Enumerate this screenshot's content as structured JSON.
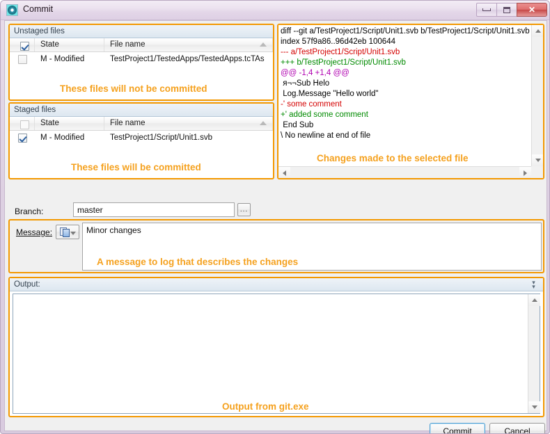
{
  "window": {
    "title": "Commit",
    "icon": "gear-icon",
    "controls": {
      "minimize": "minimize",
      "maximize": "maximize",
      "close": "✕"
    }
  },
  "unstaged": {
    "caption": "Unstaged files",
    "columns": {
      "check": "",
      "state": "State",
      "file": "File name"
    },
    "header_checkbox_checked": true,
    "rows": [
      {
        "checked": false,
        "state": "M - Modified",
        "file": "TestProject1/TestedApps/TestedApps.tcTAs"
      }
    ],
    "annotation": "These files will not be committed"
  },
  "staged": {
    "caption": "Staged files",
    "columns": {
      "check": "",
      "state": "State",
      "file": "File name"
    },
    "header_checkbox_checked": false,
    "rows": [
      {
        "checked": true,
        "state": "M - Modified",
        "file": "TestProject1/Script/Unit1.svb"
      }
    ],
    "annotation": "These files will be committed"
  },
  "diff": {
    "lines": [
      {
        "text": "diff --git a/TestProject1/Script/Unit1.svb b/TestProject1/Script/Unit1.svb",
        "kind": "ctx"
      },
      {
        "text": "index 57f9a86..96d42eb 100644",
        "kind": "ctx"
      },
      {
        "text": "--- a/TestProject1/Script/Unit1.svb",
        "kind": "del"
      },
      {
        "text": "+++ b/TestProject1/Script/Unit1.svb",
        "kind": "add"
      },
      {
        "text": "@@ -1,4 +1,4 @@",
        "kind": "hunk"
      },
      {
        "text": " я¬¬Sub Helo",
        "kind": "ctx"
      },
      {
        "text": " Log.Message \"Hello world\"",
        "kind": "ctx"
      },
      {
        "text": "-' some comment",
        "kind": "del"
      },
      {
        "text": "+' added some comment",
        "kind": "add"
      },
      {
        "text": " End Sub",
        "kind": "ctx"
      },
      {
        "text": "\\ No newline at end of file",
        "kind": "ctx"
      }
    ],
    "annotation": "Changes made to the selected file"
  },
  "branch": {
    "label": "Branch:",
    "value": "master",
    "browse_button": "...",
    "placeholder": ""
  },
  "message": {
    "label": "Message:",
    "value": "Minor changes",
    "placeholder": "",
    "toolbar_icon": "copy-icon",
    "annotation": "A message to log that describes the changes"
  },
  "output": {
    "caption": "Output:",
    "value": "",
    "collapse_icon": "chevron-double-down-icon",
    "annotation": "Output from git.exe"
  },
  "buttons": {
    "commit": "Commit",
    "cancel": "Cancel"
  },
  "colors": {
    "accent": "#f39800",
    "annotation": "#f5a11e",
    "diff_add": "#008a00",
    "diff_del": "#d40000",
    "diff_hunk": "#b000b0"
  }
}
